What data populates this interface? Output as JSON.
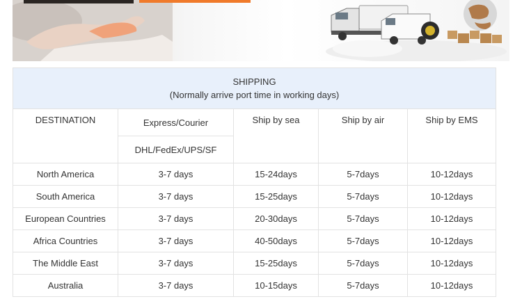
{
  "table": {
    "title": "SHIPPING",
    "subtitle": "(Normally arrive port time in working days)",
    "headers": {
      "destination": "DESTINATION",
      "express": "Express/Courier",
      "express_sub": "DHL/FedEx/UPS/SF",
      "sea": "Ship by sea",
      "air": "Ship by air",
      "ems": "Ship by EMS"
    },
    "rows": [
      {
        "destination": "North America",
        "express": "3-7 days",
        "sea": "15-24days",
        "air": "5-7days",
        "ems": "10-12days"
      },
      {
        "destination": "South America",
        "express": "3-7 days",
        "sea": "15-25days",
        "air": "5-7days",
        "ems": "10-12days"
      },
      {
        "destination": "European Countries",
        "express": "3-7 days",
        "sea": "20-30days",
        "air": "5-7days",
        "ems": "10-12days"
      },
      {
        "destination": "Africa Countries",
        "express": "3-7 days",
        "sea": "40-50days",
        "air": "5-7days",
        "ems": "10-12days"
      },
      {
        "destination": "The Middle East",
        "express": "3-7 days",
        "sea": "15-25days",
        "air": "5-7days",
        "ems": "10-12days"
      },
      {
        "destination": "Australia",
        "express": "3-7 days",
        "sea": "10-15days",
        "air": "5-7days",
        "ems": "10-12days"
      }
    ]
  },
  "colors": {
    "title_bg": "#e8f0fb",
    "border": "#e2e2e2",
    "accent_orange": "#f07a2a",
    "text": "#333333"
  }
}
